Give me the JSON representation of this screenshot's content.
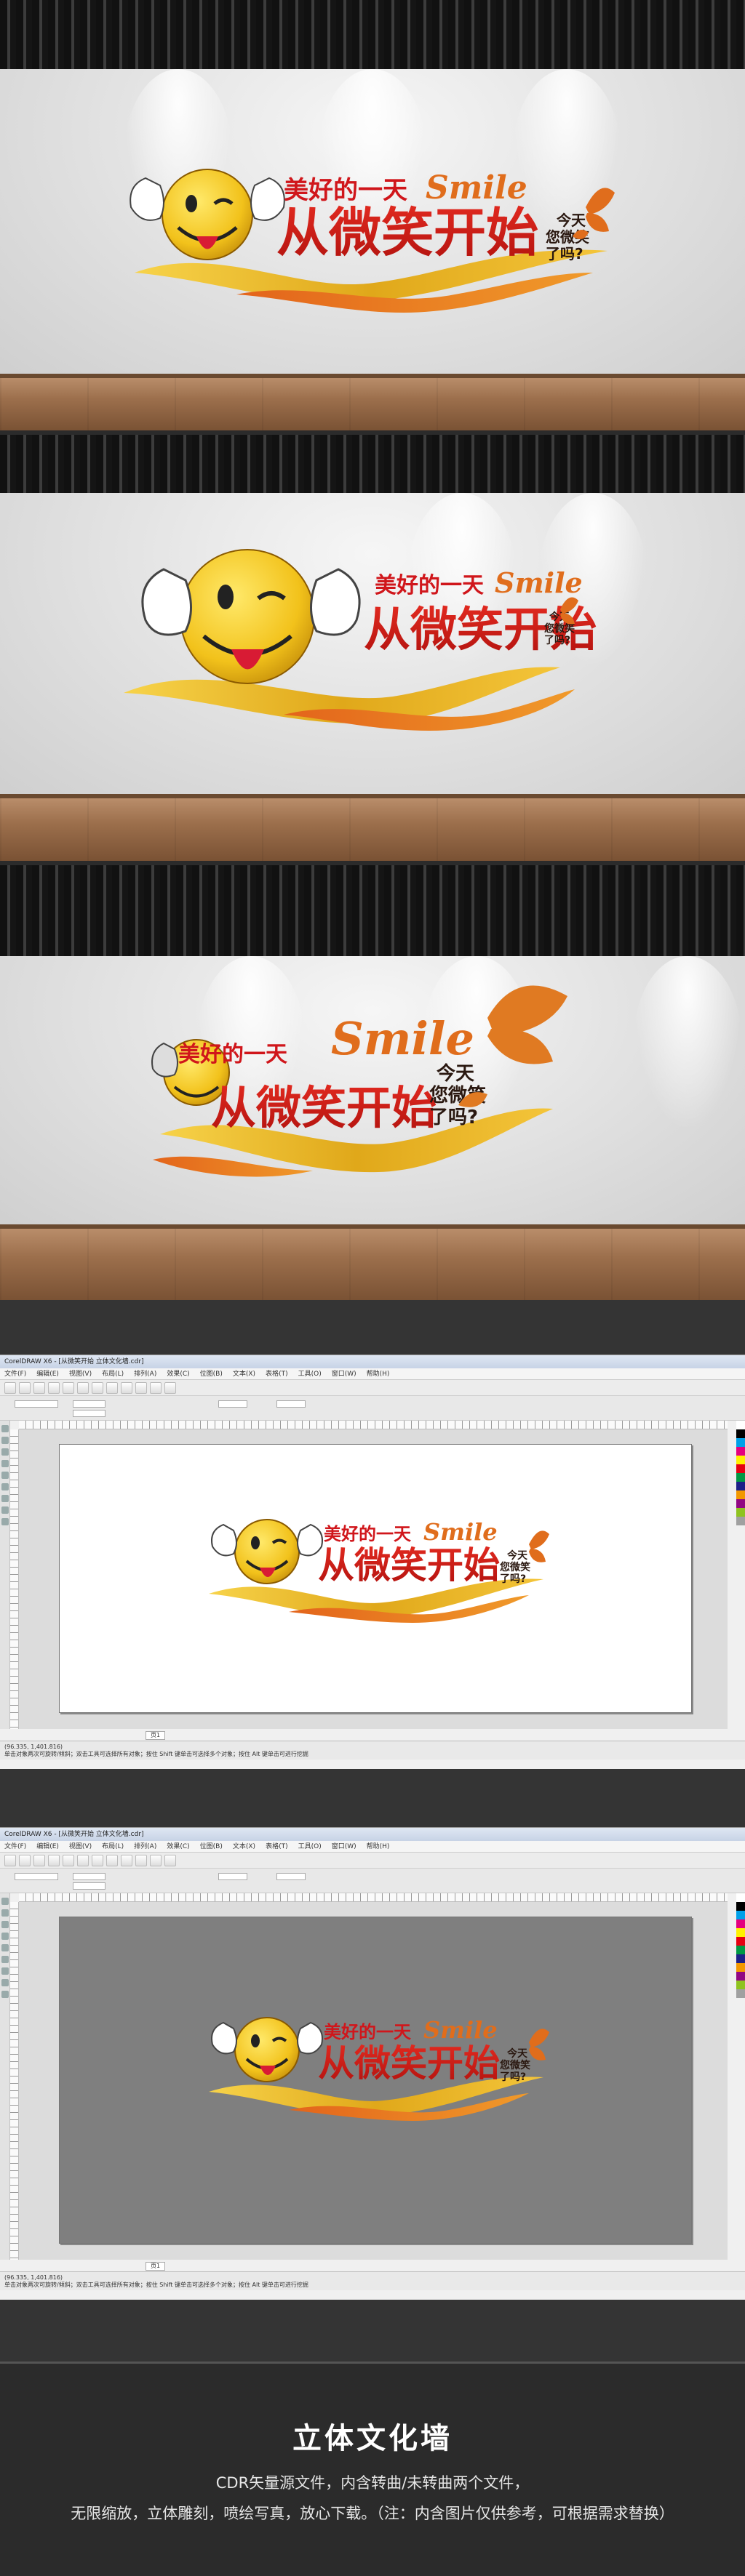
{
  "sign": {
    "line1": "美好的一天",
    "smile": "Smile",
    "main": "从微笑开始",
    "side1": "今天",
    "side2": "您微笑",
    "side3": "了吗?"
  },
  "software": {
    "titlebar": "CorelDRAW X6 - [从微笑开始 立体文化墙.cdr]",
    "menu": [
      "文件(F)",
      "编辑(E)",
      "视图(V)",
      "布局(L)",
      "排列(A)",
      "效果(C)",
      "位图(B)",
      "文本(X)",
      "表格(T)",
      "工具(O)",
      "窗口(W)",
      "帮助(H)"
    ],
    "page_tab": "页1",
    "status_left": "(96.335, 1,401.816)",
    "status_mid": "单击对象两次可旋转/倾斜；双击工具可选择所有对象；按住 Shift 键单击可选择多个对象；按住 Alt 键单击可进行挖掘"
  },
  "footer": {
    "title": "立体文化墙",
    "line1": "CDR矢量源文件，内含转曲/未转曲两个文件，",
    "line2": "无限缩放，立体雕刻，喷绘写真，放心下载。（注：内含图片仅供参考，可根据需求替换）"
  },
  "colors": {
    "smiley_yellow": "#f2c21b",
    "red": "#d0161b",
    "orange": "#e06d1c",
    "gold": "#d9a51c",
    "canvas_gray": "#7f7f7f"
  }
}
